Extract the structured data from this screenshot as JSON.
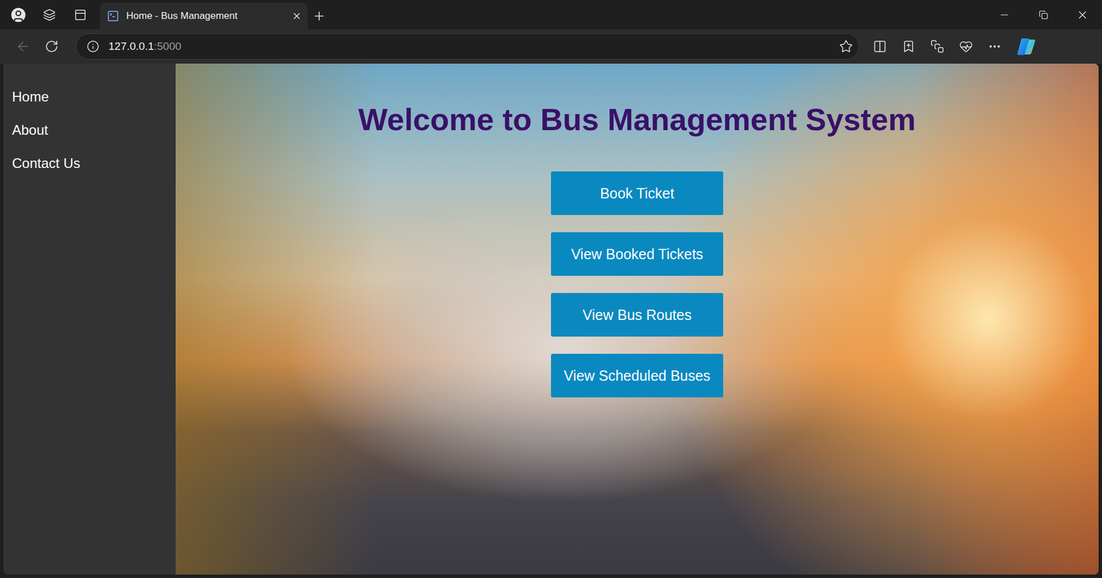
{
  "tabs": [
    {
      "label": "Home - Bus Management",
      "selected": true
    }
  ],
  "toolbar": {
    "back_disabled": true
  },
  "address": {
    "host": "127.0.0.1",
    "port": ":5000"
  },
  "sidebar": {
    "items": [
      "Home",
      "About",
      "Contact Us"
    ]
  },
  "page": {
    "heading": "Welcome to Bus Management System",
    "buttons": [
      "Book Ticket",
      "View Booked Tickets",
      "View Bus Routes",
      "View Scheduled Buses"
    ]
  }
}
